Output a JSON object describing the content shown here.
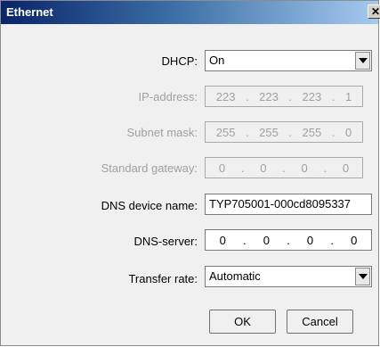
{
  "window": {
    "title": "Ethernet",
    "close_glyph": "✕"
  },
  "dhcp": {
    "label": "DHCP:",
    "value": "On"
  },
  "ip_address": {
    "label": "IP-address:",
    "octets": [
      "223",
      "223",
      "223",
      "1"
    ]
  },
  "subnet_mask": {
    "label": "Subnet mask:",
    "octets": [
      "255",
      "255",
      "255",
      "0"
    ]
  },
  "standard_gateway": {
    "label": "Standard gateway:",
    "octets": [
      "0",
      "0",
      "0",
      "0"
    ]
  },
  "dns_device_name": {
    "label": "DNS device name:",
    "value": "TYP705001-000cd8095337"
  },
  "dns_server": {
    "label": "DNS-server:",
    "octets": [
      "0",
      "0",
      "0",
      "0"
    ]
  },
  "transfer_rate": {
    "label": "Transfer rate:",
    "value": "Automatic"
  },
  "buttons": {
    "ok": "OK",
    "cancel": "Cancel"
  },
  "separator": "."
}
